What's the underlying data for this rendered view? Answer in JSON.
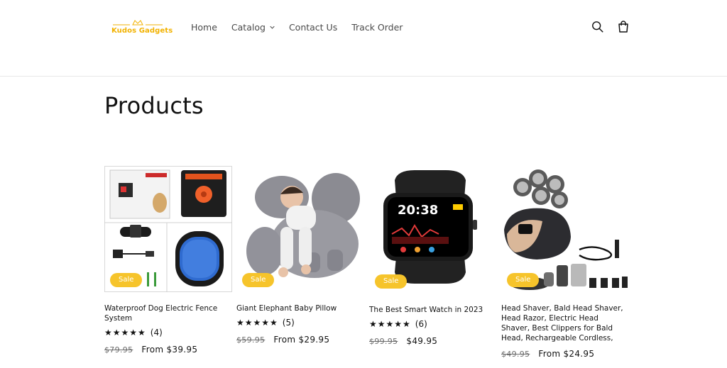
{
  "header": {
    "logo_text": "Kudos Gadgets",
    "nav": [
      {
        "label": "Home"
      },
      {
        "label": "Catalog"
      },
      {
        "label": "Contact Us"
      },
      {
        "label": "Track Order"
      }
    ],
    "icons": {
      "search": "search-icon",
      "cart": "cart-icon"
    }
  },
  "page": {
    "title": "Products"
  },
  "colors": {
    "accent": "#f6c42b",
    "text": "#121212"
  },
  "products": [
    {
      "badge": "Sale",
      "title": "Waterproof Dog Electric Fence System",
      "stars": "★★★★★",
      "reviews": "(4)",
      "old_price": "$79.95",
      "price": "From $39.95"
    },
    {
      "badge": "Sale",
      "title": "Giant Elephant Baby Pillow",
      "stars": "★★★★★",
      "reviews": "(5)",
      "old_price": "$59.95",
      "price": "From $29.95"
    },
    {
      "badge": "Sale",
      "title": "The Best Smart Watch in 2023",
      "stars": "★★★★★",
      "reviews": "(6)",
      "old_price": "$99.95",
      "price": "$49.95",
      "watch_time": "20:38"
    },
    {
      "badge": "Sale",
      "title": "Head Shaver, Bald Head Shaver, Head Razor, Electric Head Shaver, Best Clippers for Bald Head, Rechargeable Cordless,",
      "stars": "★★★★★",
      "reviews": "",
      "old_price": "$49.95",
      "price": "From $24.95"
    }
  ]
}
